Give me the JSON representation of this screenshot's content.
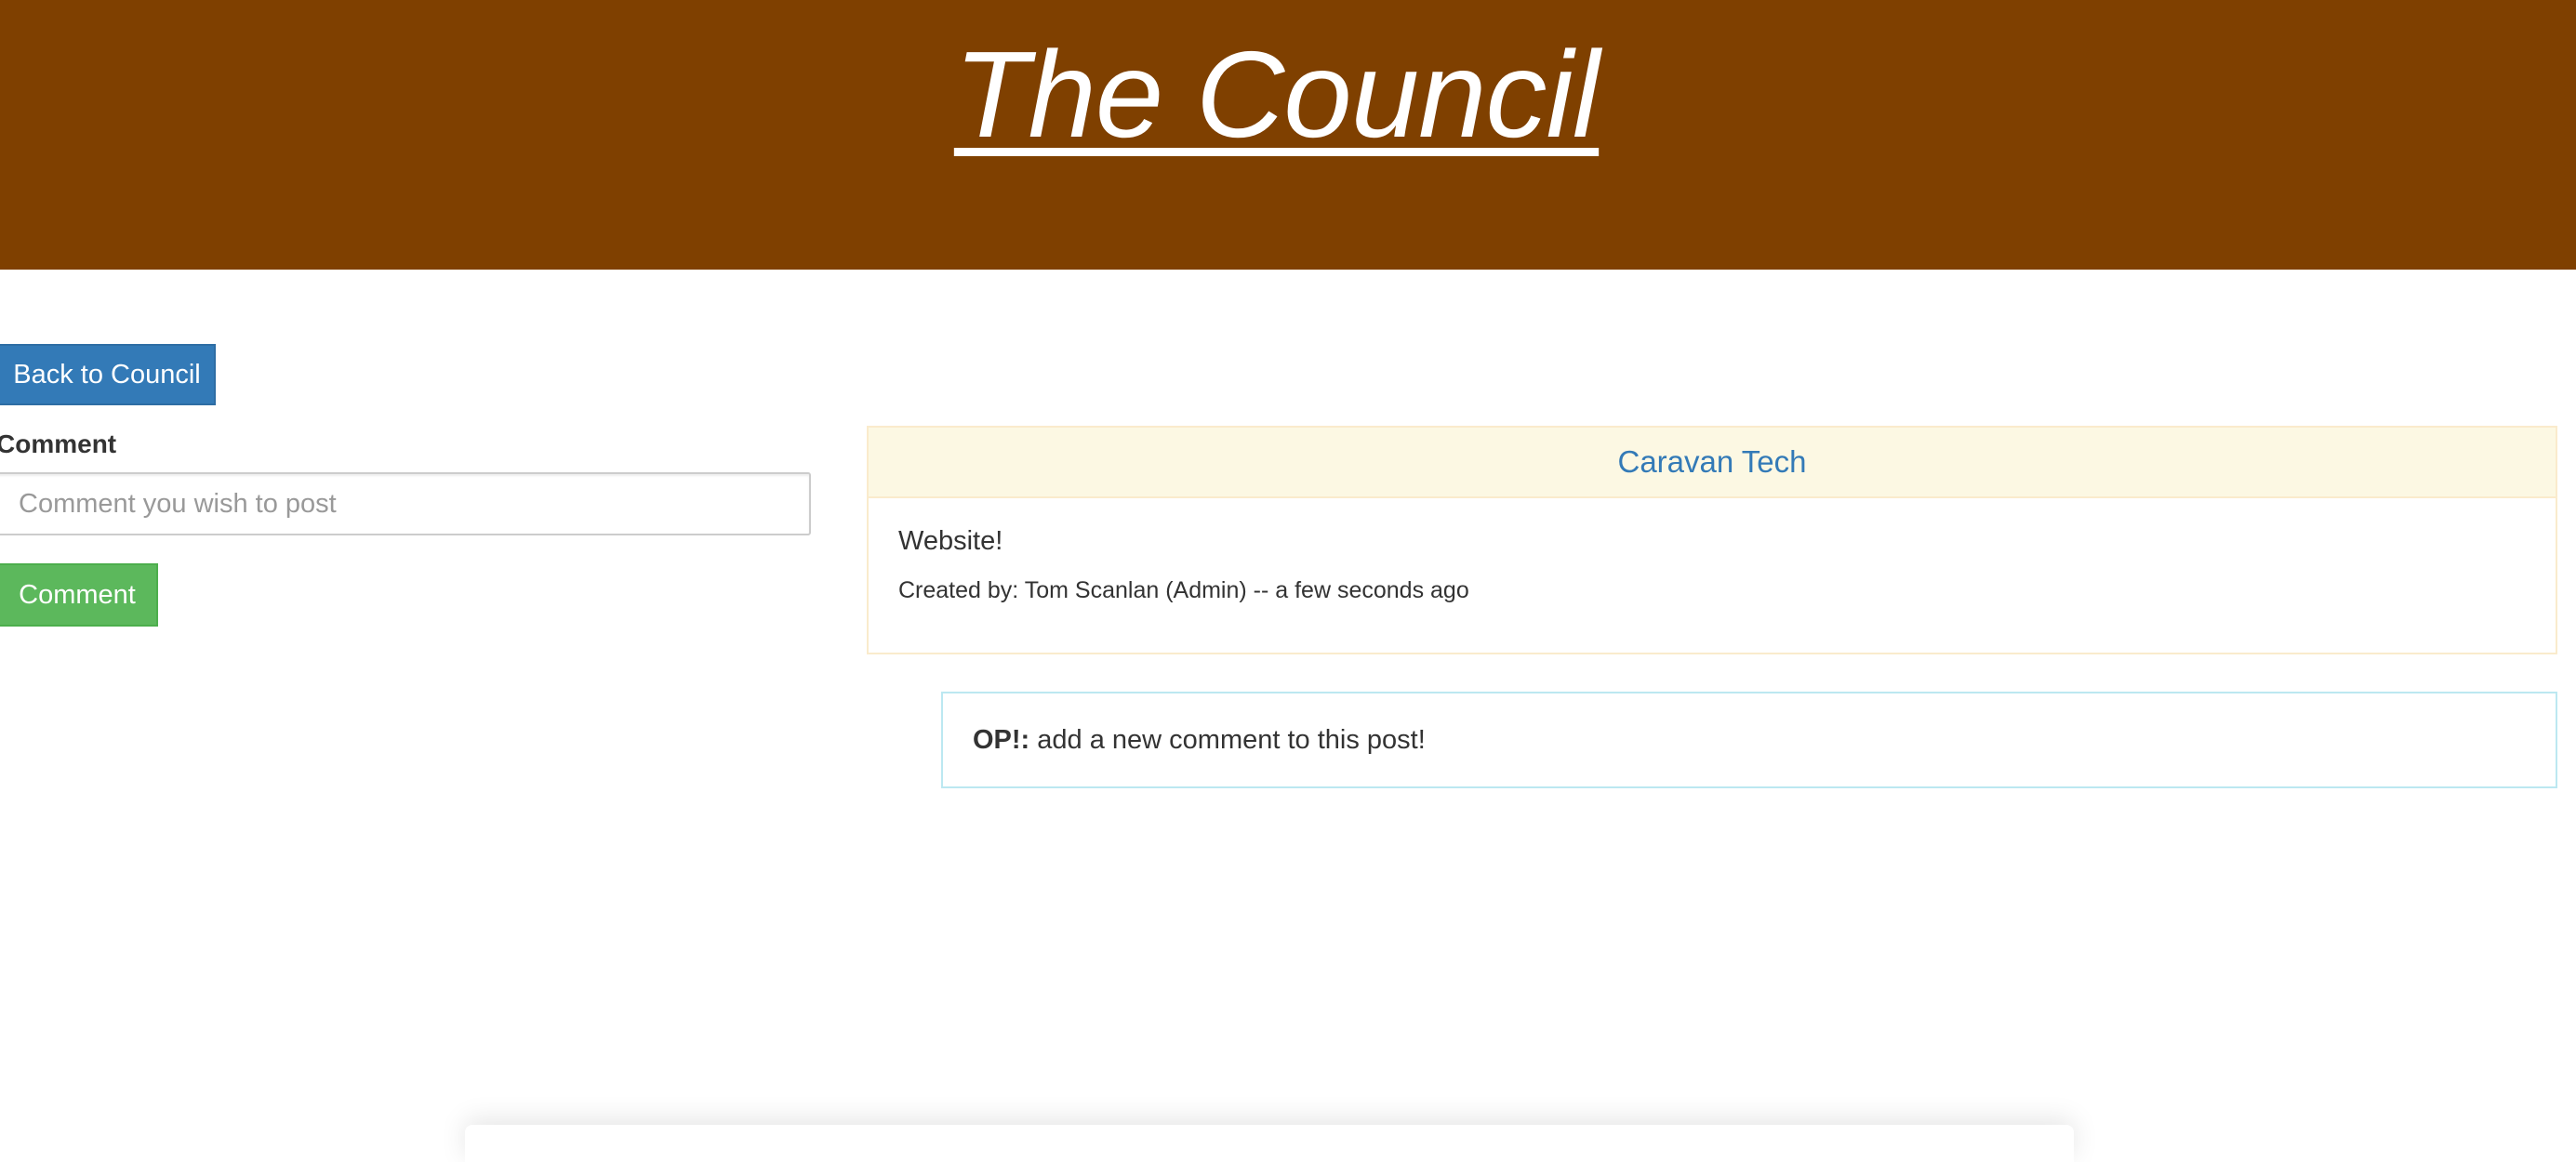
{
  "header": {
    "title": "The Council",
    "background_color": "#7f4000"
  },
  "navigation": {
    "back_label": "Back to Council"
  },
  "comment_form": {
    "label": "Comment",
    "placeholder": "Comment you wish to post",
    "value": "",
    "submit_label": "Comment"
  },
  "post": {
    "title": "Caravan Tech",
    "body": "Website!",
    "meta": "Created by: Tom Scanlan (Admin) -- a few seconds ago"
  },
  "comments": [
    {
      "author": "OP!:",
      "text": " add a new comment to this post!"
    }
  ],
  "colors": {
    "primary": "#337ab7",
    "success": "#5cb85c",
    "warning_border": "#faebcc",
    "warning_bg": "#fcf8e3",
    "info_border": "#bce8f1"
  }
}
